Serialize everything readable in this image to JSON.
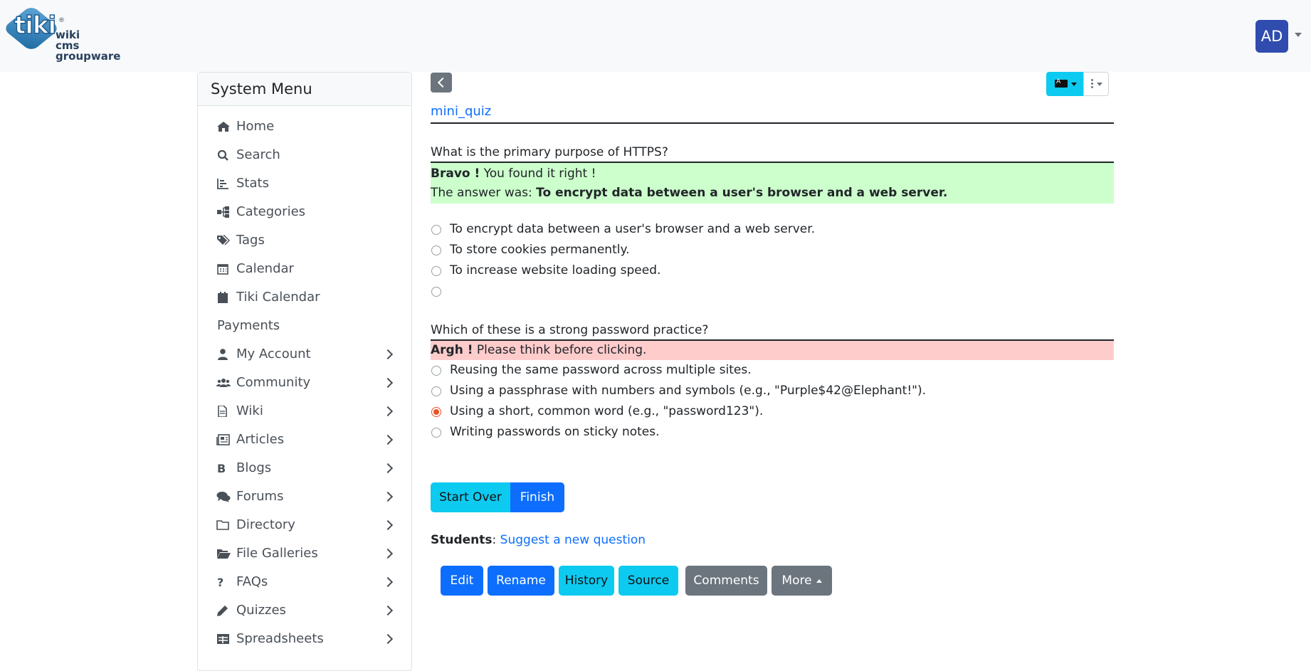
{
  "header": {
    "logo": {
      "word": "tiki",
      "tagline": [
        "wiki",
        "cms",
        "groupware"
      ]
    },
    "avatar_initials": "AD"
  },
  "sidebar": {
    "title": "System Menu",
    "items": [
      {
        "label": "Home",
        "icon": "home-icon",
        "submenu": false
      },
      {
        "label": "Search",
        "icon": "search-icon",
        "submenu": false
      },
      {
        "label": "Stats",
        "icon": "stats-icon",
        "submenu": false
      },
      {
        "label": "Categories",
        "icon": "categories-icon",
        "submenu": false
      },
      {
        "label": "Tags",
        "icon": "tags-icon",
        "submenu": false
      },
      {
        "label": "Calendar",
        "icon": "calendar-icon",
        "submenu": false
      },
      {
        "label": "Tiki Calendar",
        "icon": "calendar-filled-icon",
        "submenu": false
      },
      {
        "label": "Payments",
        "icon": "",
        "submenu": false
      },
      {
        "label": "My Account",
        "icon": "user-icon",
        "submenu": true
      },
      {
        "label": "Community",
        "icon": "users-icon",
        "submenu": true
      },
      {
        "label": "Wiki",
        "icon": "file-icon",
        "submenu": true
      },
      {
        "label": "Articles",
        "icon": "newspaper-icon",
        "submenu": true
      },
      {
        "label": "Blogs",
        "icon": "bold-icon",
        "submenu": true
      },
      {
        "label": "Forums",
        "icon": "comments-icon",
        "submenu": true
      },
      {
        "label": "Directory",
        "icon": "folder-icon",
        "submenu": true
      },
      {
        "label": "File Galleries",
        "icon": "folder-open-icon",
        "submenu": true
      },
      {
        "label": "FAQs",
        "icon": "question-icon",
        "submenu": true
      },
      {
        "label": "Quizzes",
        "icon": "pencil-icon",
        "submenu": true
      },
      {
        "label": "Spreadsheets",
        "icon": "table-icon",
        "submenu": true
      }
    ]
  },
  "main": {
    "page_name": "mini_quiz",
    "question1": {
      "text": "What is the primary purpose of HTTPS?",
      "feedback_strong": "Bravo !",
      "feedback_text": " You found it right !",
      "answer_prefix": "The answer was: ",
      "answer": "To encrypt data between a user's browser and a web server.",
      "options": [
        "To encrypt data between a user's browser and a web server.",
        "To store cookies permanently.",
        "To increase website loading speed.",
        ""
      ]
    },
    "question2": {
      "text": "Which of these is a strong password practice?",
      "feedback_strong": "Argh !",
      "feedback_text": " Please think before clicking.",
      "selected_index": 2,
      "options": [
        "Reusing the same password across multiple sites.",
        "Using a passphrase with numbers and symbols (e.g., \"Purple$42@Elephant!\").",
        "Using a short, common word (e.g., \"password123\").",
        "Writing passwords on sticky notes."
      ]
    },
    "buttons": {
      "start_over": "Start Over",
      "finish": "Finish"
    },
    "students": {
      "label": "Students",
      "link": "Suggest a new question"
    },
    "actions": {
      "edit": "Edit",
      "rename": "Rename",
      "history": "History",
      "source": "Source",
      "comments": "Comments",
      "more": "More"
    }
  }
}
